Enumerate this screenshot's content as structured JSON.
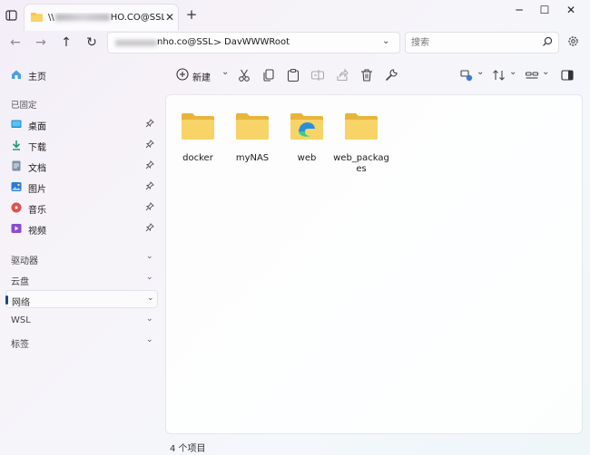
{
  "window": {
    "tab_title_prefix": "\\\\",
    "tab_title_suffix": "HO.CO@SSL\\",
    "new_tab_icon": "plus-icon",
    "close_tab_icon": "close-icon",
    "controls": {
      "minimize": "─",
      "maximize": "☐",
      "close": "✕"
    }
  },
  "nav": {
    "back": "←",
    "forward": "→",
    "up": "↑",
    "refresh": "↻"
  },
  "address": {
    "segment1": "nho.co@SSL",
    "separator": ">",
    "segment2": "DavWWWRoot"
  },
  "search": {
    "placeholder": "搜索"
  },
  "sidebar": {
    "home": "主页",
    "pinned_header": "已固定",
    "pinned": [
      {
        "label": "桌面",
        "icon": "desktop-icon",
        "color": "#1a8fd6"
      },
      {
        "label": "下载",
        "icon": "download-icon",
        "color": "#1a9a6c"
      },
      {
        "label": "文档",
        "icon": "document-icon",
        "color": "#6b7d8f"
      },
      {
        "label": "图片",
        "icon": "pictures-icon",
        "color": "#2b7ad6"
      },
      {
        "label": "音乐",
        "icon": "music-icon",
        "color": "#e0504a"
      },
      {
        "label": "视频",
        "icon": "video-icon",
        "color": "#8b4bd1"
      }
    ],
    "sections": [
      {
        "label": "驱动器"
      },
      {
        "label": "云盘"
      },
      {
        "label": "网络"
      },
      {
        "label": "WSL"
      },
      {
        "label": "标签"
      }
    ],
    "selected_section": "网络"
  },
  "toolbar": {
    "new_label": "新建",
    "buttons": [
      "cut-icon",
      "copy-icon",
      "paste-icon",
      "rename-icon",
      "share-icon",
      "delete-icon",
      "properties-icon"
    ],
    "right_buttons": [
      "view-options-icon",
      "sort-icon",
      "group-icon",
      "preview-pane-icon"
    ]
  },
  "files": [
    {
      "name": "docker",
      "icon": "folder-icon"
    },
    {
      "name": "myNAS",
      "icon": "folder-icon"
    },
    {
      "name": "web",
      "icon": "folder-edge-icon"
    },
    {
      "name": "web_packages",
      "icon": "folder-icon"
    }
  ],
  "status": {
    "item_count": "4 个项目"
  },
  "colors": {
    "folder": "#f6c84c",
    "folder_dark": "#e8b43a",
    "accent": "#1a4a7a"
  }
}
